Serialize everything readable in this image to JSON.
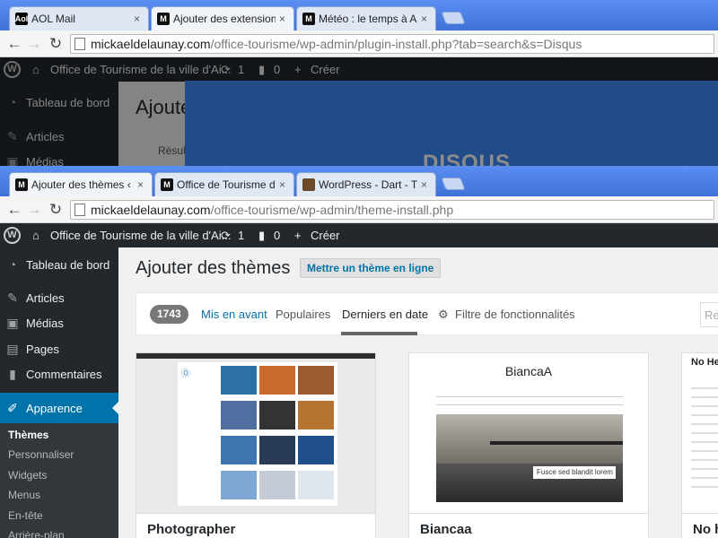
{
  "window1": {
    "tabs": [
      {
        "label": "AOL Mail",
        "favicon": "aol-favicon",
        "active": false
      },
      {
        "label": "Ajouter des extensions ‹ O",
        "favicon": "wordpress-m-favicon",
        "active": true
      },
      {
        "label": "Météo : le temps à Aigrefe",
        "favicon": "meteo-favicon",
        "active": false
      }
    ],
    "url": {
      "host": "mickaeldelaunay.com",
      "path": "/office-tourisme/wp-admin/plugin-install.php?tab=search&s=Disqus"
    },
    "adminbar": {
      "site_name": "Office de Tourisme de la ville d'Ai...",
      "updates": "1",
      "comments": "0",
      "new_label": "Créer"
    },
    "sidebar": {
      "items": [
        {
          "label": "Tableau de bord",
          "icon": "dashboard-icon"
        },
        {
          "label": "Articles",
          "icon": "pin-icon"
        },
        {
          "label": "Médias",
          "icon": "media-icon"
        }
      ]
    },
    "page_title": "Ajoute",
    "result_text": "Résult",
    "banner_text": "DISQUS",
    "banner_color": "#3d8af7"
  },
  "window2": {
    "tabs": [
      {
        "label": "Ajouter des thèmes ‹ Offic",
        "favicon": "wordpress-m-favicon",
        "active": true
      },
      {
        "label": "Office de Tourisme de la vi",
        "favicon": "wordpress-m-favicon",
        "active": false
      },
      {
        "label": "WordPress - Dart - The Ac",
        "favicon": "dart-favicon",
        "active": false
      }
    ],
    "url": {
      "host": "mickaeldelaunay.com",
      "path": "/office-tourisme/wp-admin/theme-install.php"
    },
    "adminbar": {
      "site_name": "Office de Tourisme de la ville d'Ai...",
      "updates": "1",
      "comments": "0",
      "new_label": "Créer"
    },
    "sidebar": {
      "items": [
        {
          "label": "Tableau de bord",
          "icon": "dashboard-icon"
        },
        {
          "label": "Articles",
          "icon": "pin-icon"
        },
        {
          "label": "Médias",
          "icon": "media-icon"
        },
        {
          "label": "Pages",
          "icon": "page-icon"
        },
        {
          "label": "Commentaires",
          "icon": "comment-icon"
        }
      ],
      "active_item": {
        "label": "Apparence",
        "icon": "paintbrush-icon"
      },
      "submenu": [
        "Thèmes",
        "Personnaliser",
        "Widgets",
        "Menus",
        "En-tête",
        "Arrière-plan"
      ]
    },
    "page_title": "Ajouter des thèmes",
    "upload_button": "Mettre un thème en ligne",
    "filter": {
      "count": "1743",
      "links": [
        "Mis en avant",
        "Populaires",
        "Derniers en date"
      ],
      "current": "Derniers en date",
      "feature_filter": "Filtre de fonctionnalités",
      "search_placeholder": "Rec"
    },
    "themes": [
      {
        "name": "Photographer",
        "preview": "photographer-thumbnail-grid"
      },
      {
        "name": "Biancaa",
        "preview": "biancaa-pier-photo",
        "logo": "BiancaA",
        "caption": "Fusce sed blandit lorem"
      },
      {
        "name": "No h",
        "preview": "no-header-text-list",
        "heading": "No Hea"
      }
    ],
    "accent": "#0073aa"
  }
}
